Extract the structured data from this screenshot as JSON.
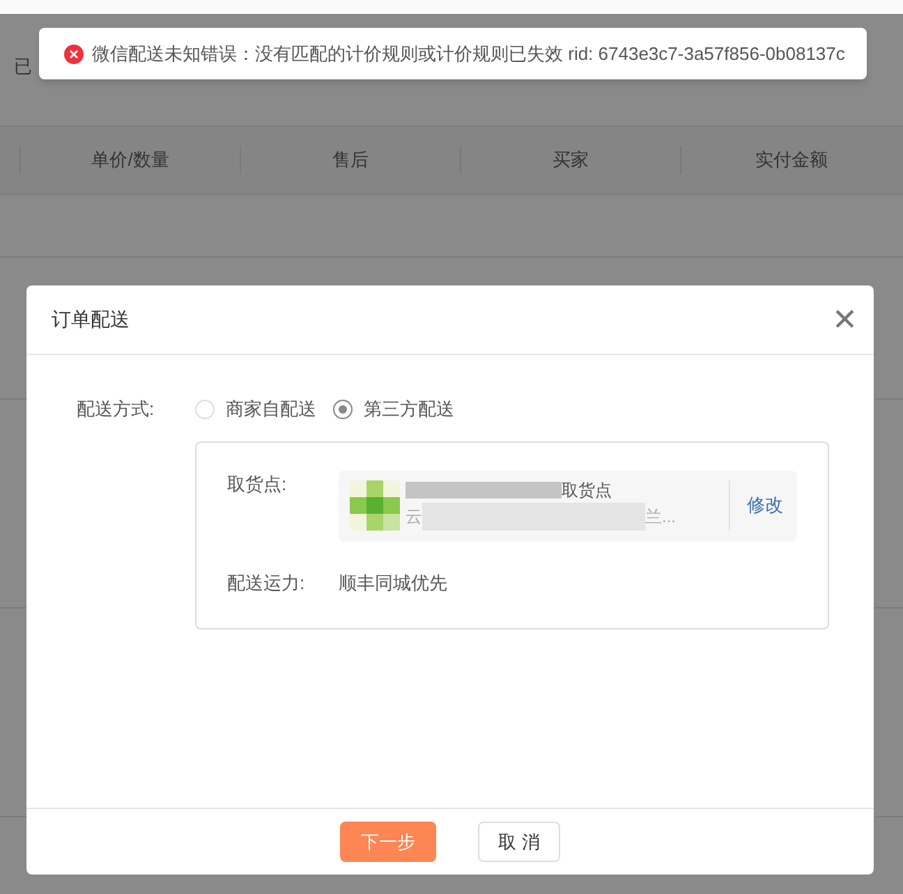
{
  "background_page": {
    "status_text": "已",
    "columns": [
      "单价/数量",
      "售后",
      "买家",
      "实付金额"
    ]
  },
  "toast": {
    "kind": "error",
    "message": "微信配送未知错误：没有匹配的计价规则或计价规则已失效 rid: 6743e3c7-3a57f856-0b08137c"
  },
  "dialog": {
    "title": "订单配送",
    "close": "✕",
    "delivery_method": {
      "label": "配送方式:",
      "options": [
        {
          "label": "商家自配送",
          "selected": false
        },
        {
          "label": "第三方配送",
          "selected": true
        }
      ]
    },
    "pickup_point": {
      "label": "取货点:",
      "name_visible": "取货点",
      "address_start": "云",
      "address_end": "兰...",
      "edit_link": "修改"
    },
    "carrier": {
      "label": "配送运力:",
      "value": "顺丰同城优先"
    },
    "buttons": [
      {
        "label": "下一步",
        "kind": "primary"
      },
      {
        "label": "取 消",
        "kind": "secondary"
      }
    ]
  }
}
